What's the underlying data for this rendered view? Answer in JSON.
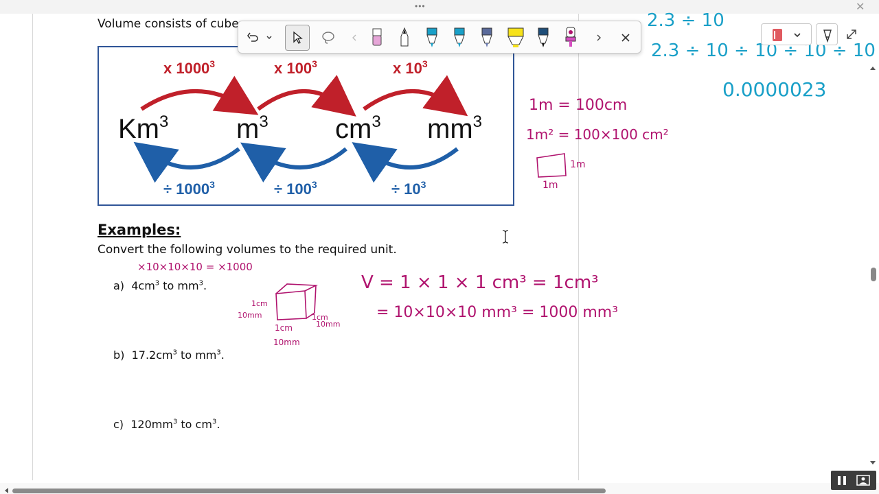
{
  "document": {
    "intro_text": "Volume consists of cube",
    "examples_heading": "Examples:",
    "instruction": "Convert the following volumes to the required unit.",
    "examples": [
      {
        "letter": "a)",
        "value": "4cm",
        "sup1": "3",
        "mid": " to mm",
        "sup2": "3",
        "end": "."
      },
      {
        "letter": "b)",
        "value": "17.2cm",
        "sup1": "3",
        "mid": " to mm",
        "sup2": "3",
        "end": "."
      },
      {
        "letter": "c)",
        "value": "120mm",
        "sup1": "3",
        "mid": " to cm",
        "sup2": "3",
        "end": "."
      }
    ]
  },
  "diagram": {
    "units": [
      "Km",
      "m",
      "cm",
      "mm"
    ],
    "unit_sup": "3",
    "multipliers": [
      "x 1000",
      "x 100",
      "x 10"
    ],
    "dividers": [
      "÷ 1000",
      "÷ 100",
      "÷ 10"
    ],
    "power_sup": "3",
    "colors": {
      "multiply": "#c0202a",
      "divide": "#1f5fa8",
      "border": "#2f5597"
    }
  },
  "ink": {
    "magenta_color": "#b0136e",
    "cyan_color": "#1aa0c8",
    "top_right_partial": "2.3 ÷ 10",
    "chain": "2.3 ÷ 10 ÷ 10 ÷ 10 ÷ 10",
    "result": "0.0000023",
    "m_to_cm": "1m = 100cm",
    "m2_to_cm2": "1m² = 100×100 cm²",
    "square_side_label": "1m",
    "square_bottom_label": "1m",
    "example_a_factor": "×10×10×10 = ×1000",
    "cube_left_label_1": "1cm",
    "cube_left_label_2": "10mm",
    "cube_right_label_1": "1cm",
    "cube_right_label_2": "10mm",
    "cube_bottom_label_1": "1cm",
    "cube_bottom_label_2": "10mm",
    "volume_line_1": "V = 1 × 1 × 1 cm³ = 1cm³",
    "volume_line_2": "= 10×10×10 mm³ = 1000 mm³"
  },
  "toolbar": {
    "icons": [
      "undo-icon",
      "chevron-down-icon",
      "select-pointer-icon",
      "lasso-icon",
      "chevron-left-icon",
      "eraser-icon",
      "pen-black-icon",
      "highlighter-cyan-icon",
      "pen-cyan-icon",
      "pen-galaxy-icon",
      "highlighter-yellow-icon",
      "fountain-pen-icon",
      "pen-magenta-icon",
      "chevron-right-icon",
      "close-icon"
    ]
  },
  "app": {
    "grip": "•••",
    "close_glyph": "✕"
  }
}
